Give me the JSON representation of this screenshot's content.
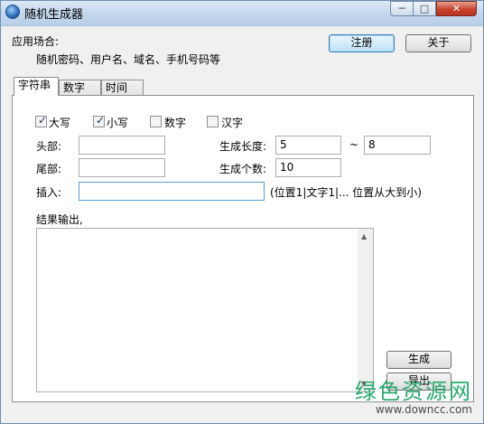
{
  "window": {
    "title": "随机生成器"
  },
  "controls": {
    "minimize": "─",
    "maximize": "□",
    "close": "✕"
  },
  "header": {
    "usage_label": "应用场合:",
    "usage_desc": "随机密码、用户名、域名、手机号码等",
    "register_label": "注册",
    "about_label": "关于"
  },
  "tabs": [
    {
      "label": "字符串"
    },
    {
      "label": "数字"
    },
    {
      "label": "时间"
    }
  ],
  "options": {
    "upper": {
      "label": "大写",
      "checked": true
    },
    "lower": {
      "label": "小写",
      "checked": true
    },
    "digits": {
      "label": "数字",
      "checked": false
    },
    "chinese": {
      "label": "汉字",
      "checked": false
    }
  },
  "form": {
    "head_label": "头部:",
    "head_value": "",
    "tail_label": "尾部:",
    "tail_value": "",
    "insert_label": "插入:",
    "insert_value": "",
    "insert_hint": "(位置1|文字1|... 位置从大到小)",
    "length_label": "生成长度:",
    "length_min": "5",
    "length_sep": "~",
    "length_max": "8",
    "count_label": "生成个数:",
    "count_value": "10"
  },
  "output": {
    "label": "结果输出,",
    "content": ""
  },
  "actions": {
    "generate_label": "生成",
    "export_label": "导出"
  },
  "watermark": {
    "text": "绿色资源网",
    "url": "www.downcc.com",
    "color": "#27a96e"
  }
}
